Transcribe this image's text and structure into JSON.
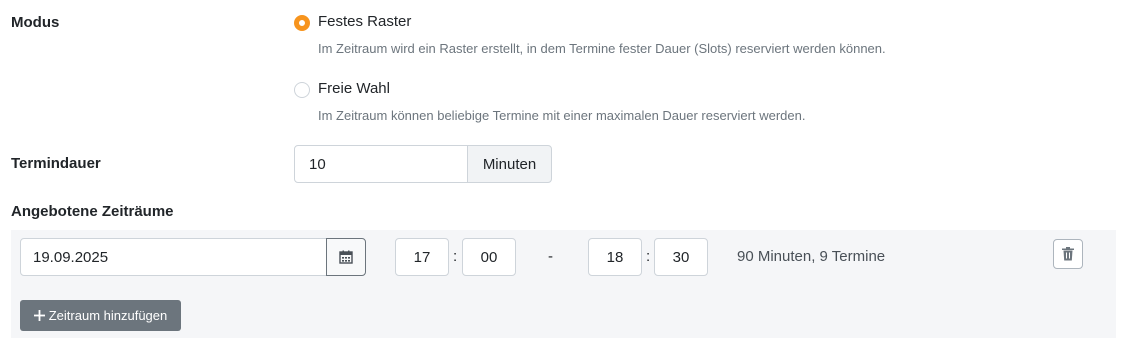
{
  "modus": {
    "label": "Modus",
    "options": [
      {
        "label": "Festes Raster",
        "help": "Im Zeitraum wird ein Raster erstellt, in dem Termine fester Dauer (Slots) reserviert werden können.",
        "checked": true
      },
      {
        "label": "Freie Wahl",
        "help": "Im Zeitraum können beliebige Termine mit einer maximalen Dauer reserviert werden.",
        "checked": false
      }
    ]
  },
  "termindauer": {
    "label": "Termindauer",
    "value": "10",
    "unit": "Minuten"
  },
  "zeitraeume": {
    "label": "Angebotene Zeiträume",
    "rows": [
      {
        "date": "19.09.2025",
        "start_hour": "17",
        "start_minute": "00",
        "range_sep": "-",
        "time_sep": ":",
        "end_hour": "18",
        "end_minute": "30",
        "summary": "90 Minuten, 9 Termine"
      }
    ],
    "add_button": {
      "icon": "plus-icon",
      "label": "Zeitraum hinzufügen"
    }
  },
  "colors": {
    "accent": "#f7941d",
    "panel": "#f5f6f8",
    "button": "#6c757d"
  },
  "icons": [
    "calendar-icon",
    "trash-icon",
    "plus-icon"
  ]
}
